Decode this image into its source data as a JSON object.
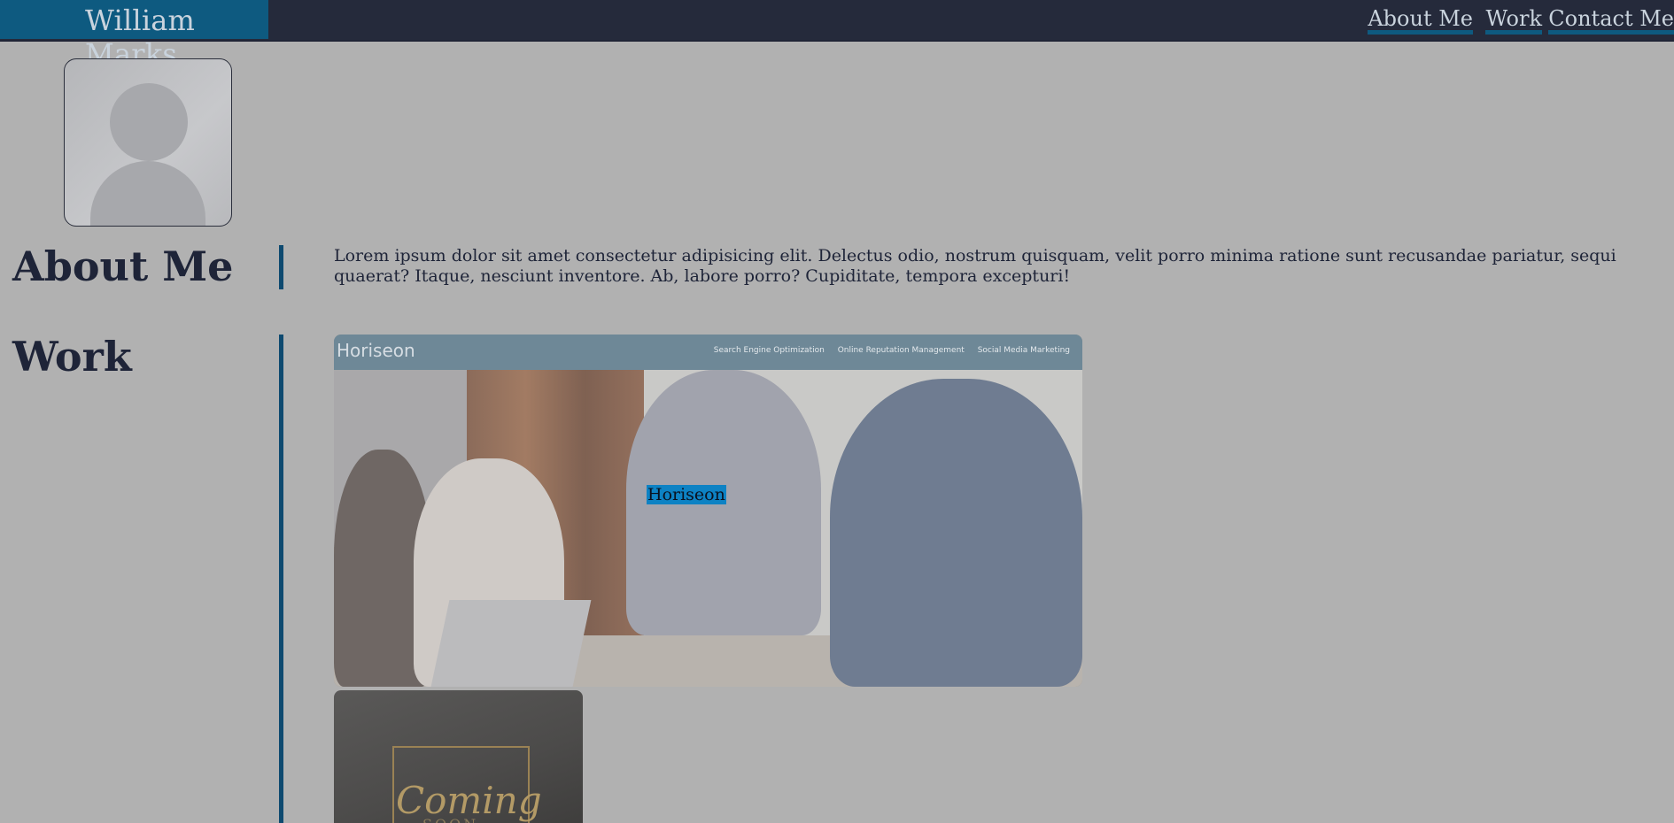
{
  "header": {
    "brand": "William Marks",
    "nav": [
      {
        "label": "About Me"
      },
      {
        "label": "Work"
      },
      {
        "label": "Contact Me"
      }
    ]
  },
  "about": {
    "title": "About Me",
    "text": "Lorem ipsum dolor sit amet consectetur adipisicing elit. Delectus odio, nostrum quisquam, velit porro minima ratione sunt recusandae pariatur, sequi quaerat? Itaque, nesciunt inventore. Ab, labore porro? Cupiditate, tempora excepturi!"
  },
  "work": {
    "title": "Work",
    "projects": [
      {
        "label": "Horiseon",
        "screenshot_logo": "Horiseon",
        "screenshot_links": [
          "Search Engine Optimization",
          "Online Reputation Management",
          "Social Media Marketing"
        ]
      },
      {
        "screenshot_text": "Coming",
        "screenshot_subtext": "SOON"
      }
    ]
  },
  "colors": {
    "page_bg": "#b1b1b1",
    "header_bg": "#252a3b",
    "accent": "#0e5a80",
    "heading": "#1e2438",
    "label_bg": "#0d82c4"
  }
}
